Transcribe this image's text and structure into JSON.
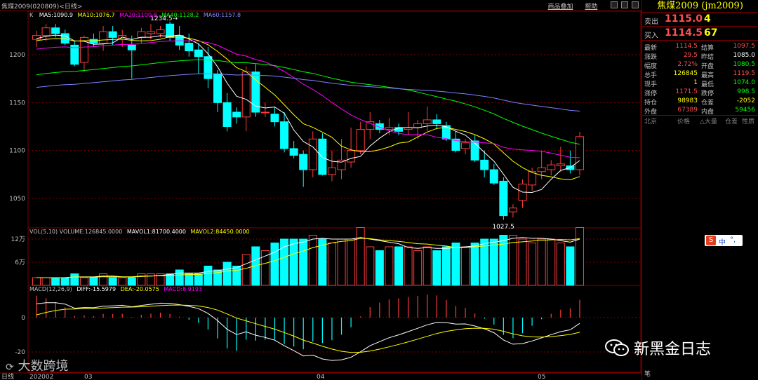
{
  "window": {
    "title": "焦煤2009(020809)<日线>",
    "links": [
      "商品叠加",
      "帮助"
    ]
  },
  "main_legend": {
    "label": "K",
    "ma5": "MA5:1090.9",
    "ma10": "MA10:1076.7",
    "ma20": "MA20:1100.8",
    "ma40": "MA40:1128.2",
    "ma60": "MA60:1157.8"
  },
  "vol_legend": {
    "vol": "VOL(5,10) VOLUME:126845.0000",
    "mavol1": "MAVOL1:81700.4000",
    "mavol2": "MAVOL2:84450.0000"
  },
  "macd_legend": {
    "macd": "MACD(12,26,9)",
    "diff": "DIFF:-15.5979",
    "dea": "DEA:-20.0575",
    "macdv": "MACD:8.9193"
  },
  "annotations": {
    "high": "1234.5",
    "low": "1027.5"
  },
  "axis": {
    "price_ticks": [
      "1200",
      "1150",
      "1100",
      "1050"
    ],
    "vol_ticks": [
      "12万",
      "6万"
    ],
    "macd_ticks": [
      "0",
      "-20"
    ],
    "date_labels": [
      "日线",
      "202002",
      "03",
      "04",
      "05"
    ]
  },
  "colors": {
    "up": "#ff3c3c",
    "down": "#00ffff",
    "ma5": "#ffffff",
    "ma10": "#ffff00",
    "ma20": "#ff00ff",
    "ma40": "#00ff00",
    "ma60": "#8080ff",
    "grid": "#800000"
  },
  "quote": {
    "name": "焦煤2009 (jm2009)",
    "sell_label": "卖出",
    "sell_price": "1115.0",
    "sell_vol": "4",
    "buy_label": "买入",
    "buy_price": "1114.5",
    "buy_vol": "67",
    "stats": [
      [
        "最新",
        "1114.5",
        "结算",
        "1097.5"
      ],
      [
        "涨跌",
        "29.5",
        "昨结",
        "1085.0"
      ],
      [
        "幅度",
        "2.72%",
        "开盘",
        "1080.5"
      ],
      [
        "总手",
        "126845",
        "最高",
        "1119.5"
      ],
      [
        "现手",
        "1",
        "最低",
        "1074.0"
      ],
      [
        "涨停",
        "1171.5",
        "跌停",
        "998.5"
      ],
      [
        "持仓",
        "98983",
        "仓差",
        "-2052"
      ],
      [
        "外盘",
        "67389",
        "内盘",
        "59456"
      ]
    ],
    "tick_headers": [
      "北京",
      "价格",
      "△大量",
      "仓差",
      "性质"
    ]
  },
  "watermark": "新黑金日志",
  "watermark_logo": "大数跨境",
  "im_badge": "中"
}
